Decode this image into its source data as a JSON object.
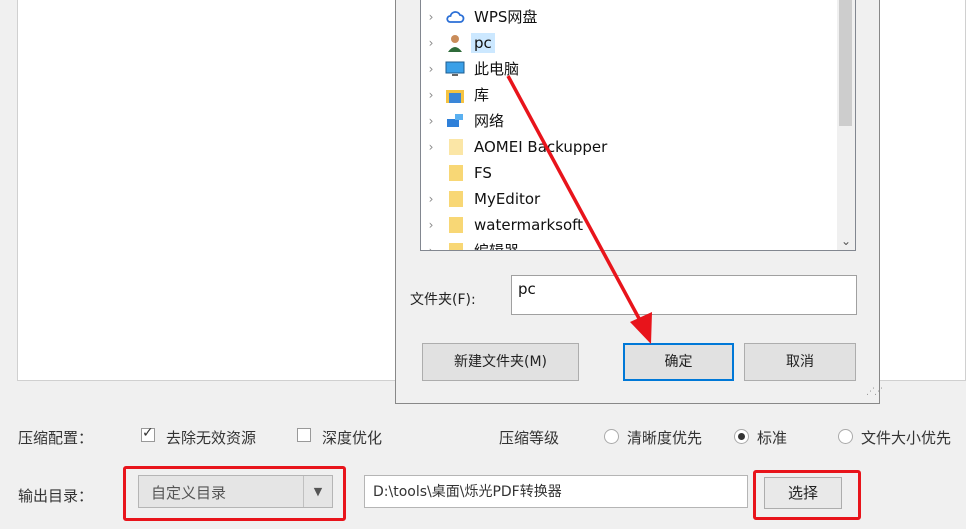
{
  "dialog": {
    "tree": [
      {
        "label": "WPS网盘",
        "icon": "cloud-icon"
      },
      {
        "label": "pc",
        "icon": "user-icon",
        "selected": true
      },
      {
        "label": "此电脑",
        "icon": "computer-icon"
      },
      {
        "label": "库",
        "icon": "library-icon"
      },
      {
        "label": "网络",
        "icon": "network-icon"
      },
      {
        "label": "AOMEI Backupper",
        "icon": "folder-icon"
      },
      {
        "label": "FS",
        "icon": "folder-icon"
      },
      {
        "label": "MyEditor",
        "icon": "folder-icon"
      },
      {
        "label": "watermarksoft",
        "icon": "folder-icon"
      },
      {
        "label": "编辑器",
        "icon": "folder-icon"
      }
    ],
    "folder_label": "文件夹(F):",
    "folder_value": "pc",
    "new_folder_label": "新建文件夹(M)",
    "ok_label": "确定",
    "cancel_label": "取消"
  },
  "options": {
    "compress_config_label": "压缩配置：",
    "remove_invalid_label": "去除无效资源",
    "remove_invalid_checked": true,
    "deep_optimize_label": "深度优化",
    "deep_optimize_checked": false,
    "compress_level_label": "压缩等级",
    "levels": [
      {
        "label": "清晰度优先",
        "checked": false
      },
      {
        "label": "标准",
        "checked": true
      },
      {
        "label": "文件大小优先",
        "checked": false
      }
    ]
  },
  "output": {
    "label": "输出目录：",
    "mode_value": "自定义目录",
    "path_value": "D:\\tools\\桌面\\烁光PDF转换器",
    "choose_label": "选择"
  },
  "colors": {
    "highlight": "#e8141b",
    "primary_border": "#0078d7",
    "selection": "#cce8ff"
  }
}
